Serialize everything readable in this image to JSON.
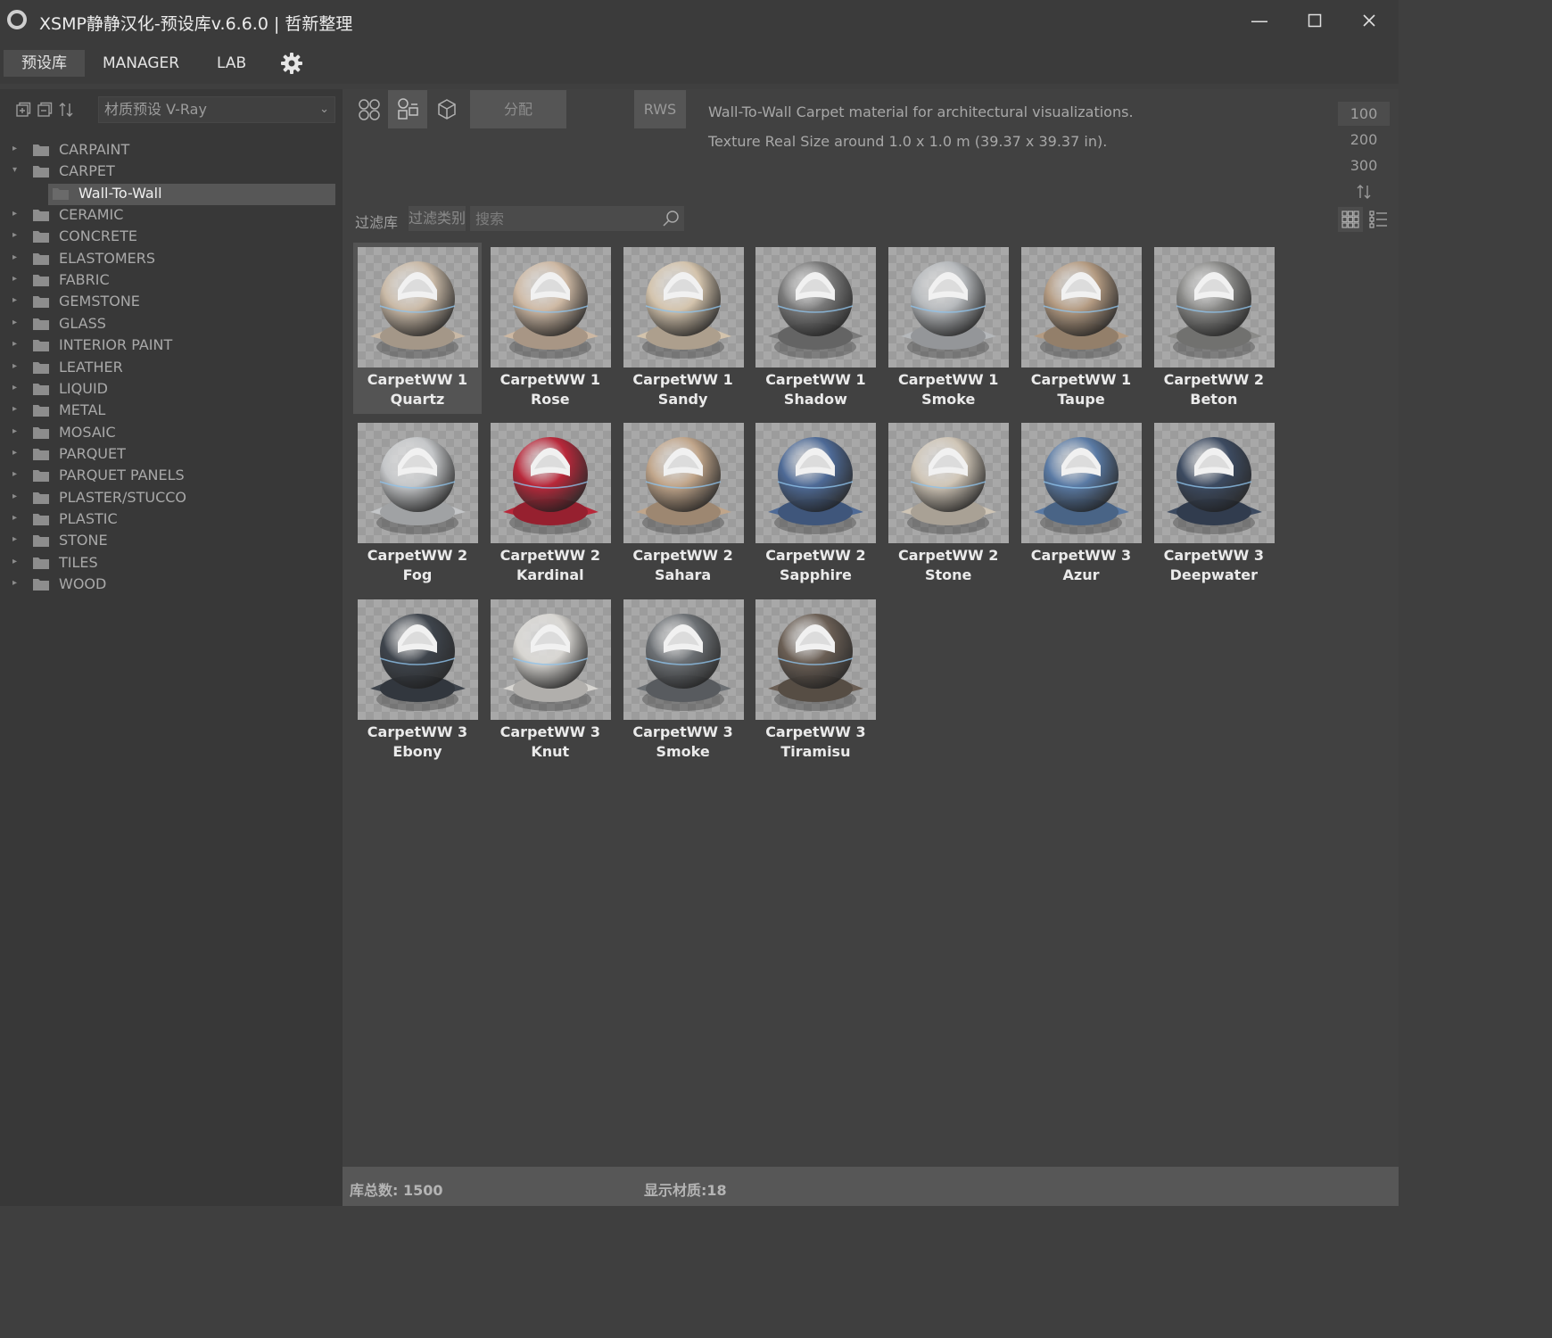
{
  "window": {
    "title": "XSMP静静汉化-预设库v.6.6.0 | 哲新整理",
    "minimize_icon": "minimize-icon",
    "maximize_icon": "maximize-icon",
    "close_icon": "close-icon"
  },
  "menu": {
    "tabs": [
      "预设库",
      "MANAGER",
      "LAB"
    ],
    "active_tab": "预设库",
    "settings_icon": "gear-icon"
  },
  "sidebar": {
    "preset_select": "材质预设 V-Ray",
    "tree": [
      {
        "label": "CARPAINT",
        "expanded": false
      },
      {
        "label": "CARPET",
        "expanded": true
      },
      {
        "label": "Wall-To-Wall",
        "child": true,
        "selected": true
      },
      {
        "label": "CERAMIC",
        "expanded": false
      },
      {
        "label": "CONCRETE",
        "expanded": false
      },
      {
        "label": "ELASTOMERS",
        "expanded": false
      },
      {
        "label": "FABRIC",
        "expanded": false
      },
      {
        "label": "GEMSTONE",
        "expanded": false
      },
      {
        "label": "GLASS",
        "expanded": false
      },
      {
        "label": "INTERIOR PAINT",
        "expanded": false
      },
      {
        "label": "LEATHER",
        "expanded": false
      },
      {
        "label": "LIQUID",
        "expanded": false
      },
      {
        "label": "METAL",
        "expanded": false
      },
      {
        "label": "MOSAIC",
        "expanded": false
      },
      {
        "label": "PARQUET",
        "expanded": false
      },
      {
        "label": "PARQUET PANELS",
        "expanded": false
      },
      {
        "label": "PLASTER/STUCCO",
        "expanded": false
      },
      {
        "label": "PLASTIC",
        "expanded": false
      },
      {
        "label": "STONE",
        "expanded": false
      },
      {
        "label": "TILES",
        "expanded": false
      },
      {
        "label": "WOOD",
        "expanded": false
      }
    ]
  },
  "toolbar": {
    "assign_label": "分配",
    "rws_label": "RWS"
  },
  "description": {
    "line1": "Wall-To-Wall Carpet material for architectural visualizations.",
    "line2": "Texture Real Size around 1.0 x 1.0 m (39.37 x 39.37 in)."
  },
  "thumb_sizes": [
    "100",
    "200",
    "300"
  ],
  "active_thumb_size": "100",
  "filter": {
    "library_label": "过滤库",
    "category_label": "过滤类别",
    "search_placeholder": "搜索"
  },
  "materials": [
    {
      "line1": "CarpetWW 1",
      "line2": "Quartz",
      "color": "#c9b9a6",
      "selected": true
    },
    {
      "line1": "CarpetWW 1",
      "line2": "Rose",
      "color": "#cdb8a3"
    },
    {
      "line1": "CarpetWW 1",
      "line2": "Sandy",
      "color": "#d3c3ac"
    },
    {
      "line1": "CarpetWW 1",
      "line2": "Shadow",
      "color": "#7a7a7a"
    },
    {
      "line1": "CarpetWW 1",
      "line2": "Smoke",
      "color": "#b5b8bb"
    },
    {
      "line1": "CarpetWW 1",
      "line2": "Taupe",
      "color": "#b49b82"
    },
    {
      "line1": "CarpetWW 2",
      "line2": "Beton",
      "color": "#8a8a88"
    },
    {
      "line1": "CarpetWW 2",
      "line2": "Fog",
      "color": "#c4c6c8"
    },
    {
      "line1": "CarpetWW 2",
      "line2": "Kardinal",
      "color": "#b8283a"
    },
    {
      "line1": "CarpetWW 2",
      "line2": "Sahara",
      "color": "#c0a58a"
    },
    {
      "line1": "CarpetWW 2",
      "line2": "Sapphire",
      "color": "#4e6a96"
    },
    {
      "line1": "CarpetWW 2",
      "line2": "Stone",
      "color": "#cfc5b6"
    },
    {
      "line1": "CarpetWW 3",
      "line2": "Azur",
      "color": "#5a7aa4"
    },
    {
      "line1": "CarpetWW 3",
      "line2": "Deepwater",
      "color": "#3c4a60"
    },
    {
      "line1": "CarpetWW 3",
      "line2": "Ebony",
      "color": "#3e444c"
    },
    {
      "line1": "CarpetWW 3",
      "line2": "Knut",
      "color": "#d8d6d2"
    },
    {
      "line1": "CarpetWW 3",
      "line2": "Smoke",
      "color": "#6c7074"
    },
    {
      "line1": "CarpetWW 3",
      "line2": "Tiramisu",
      "color": "#6a5e54"
    }
  ],
  "status": {
    "total_label": "库总数: 1500",
    "shown_label": "显示材质:18"
  }
}
